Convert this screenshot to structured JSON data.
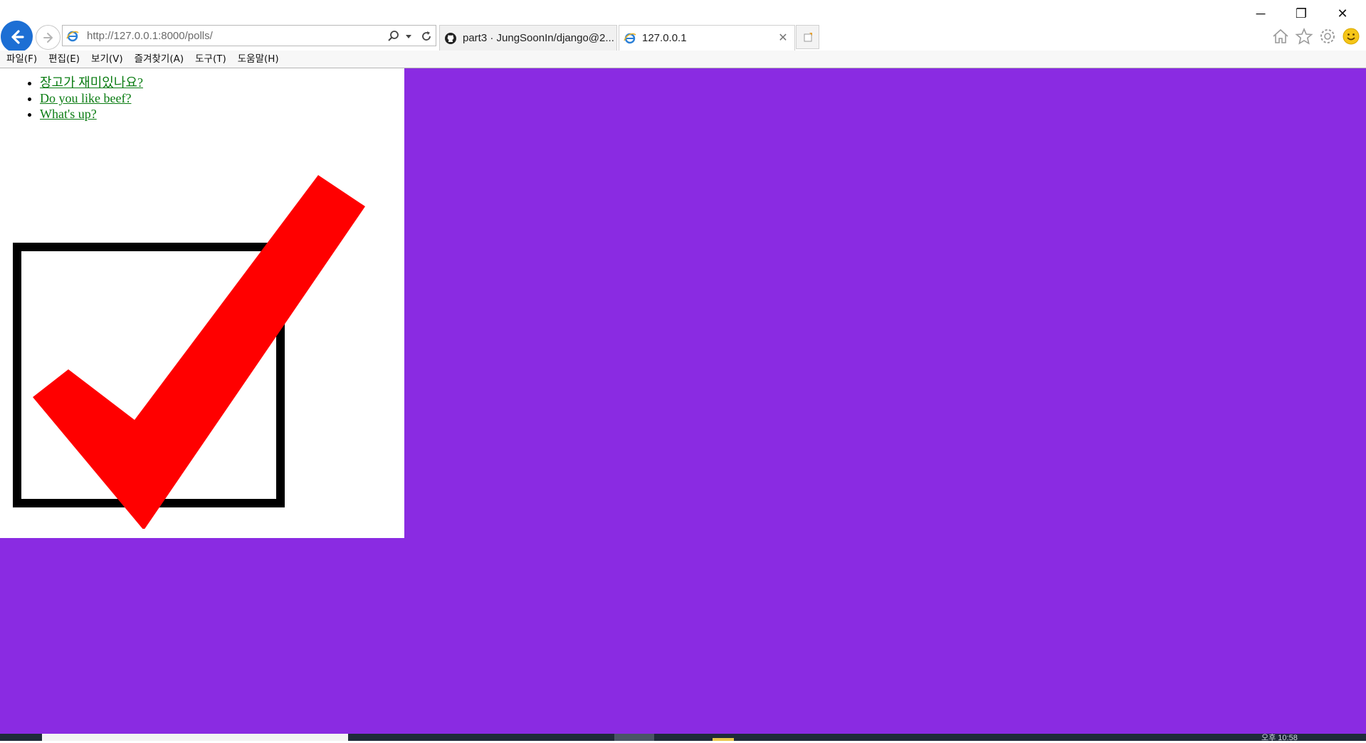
{
  "window": {
    "minimize_glyph": "─",
    "restore_glyph": "❐",
    "close_glyph": "✕"
  },
  "address_bar": {
    "url": "http://127.0.0.1:8000/polls/"
  },
  "tabs": [
    {
      "label": "part3 · JungSoonIn/django@2...",
      "icon": "github-icon",
      "active": false
    },
    {
      "label": "127.0.0.1",
      "icon": "ie-icon",
      "active": true,
      "close": "✕"
    }
  ],
  "menu": {
    "items": [
      "파일(F)",
      "편집(E)",
      "보기(V)",
      "즐겨찾기(A)",
      "도구(T)",
      "도움말(H)"
    ]
  },
  "page": {
    "background_color": "#8a2be2",
    "link_color": "#0a7c12",
    "questions": [
      {
        "text": "장고가 재미있나요?"
      },
      {
        "text": "Do you like beef?"
      },
      {
        "text": "What's up?"
      }
    ],
    "image": {
      "subject": "checkmark-in-box",
      "check_color": "#ff0000",
      "box_color": "#000000"
    }
  },
  "taskbar": {
    "clock": "오후 10:58"
  }
}
